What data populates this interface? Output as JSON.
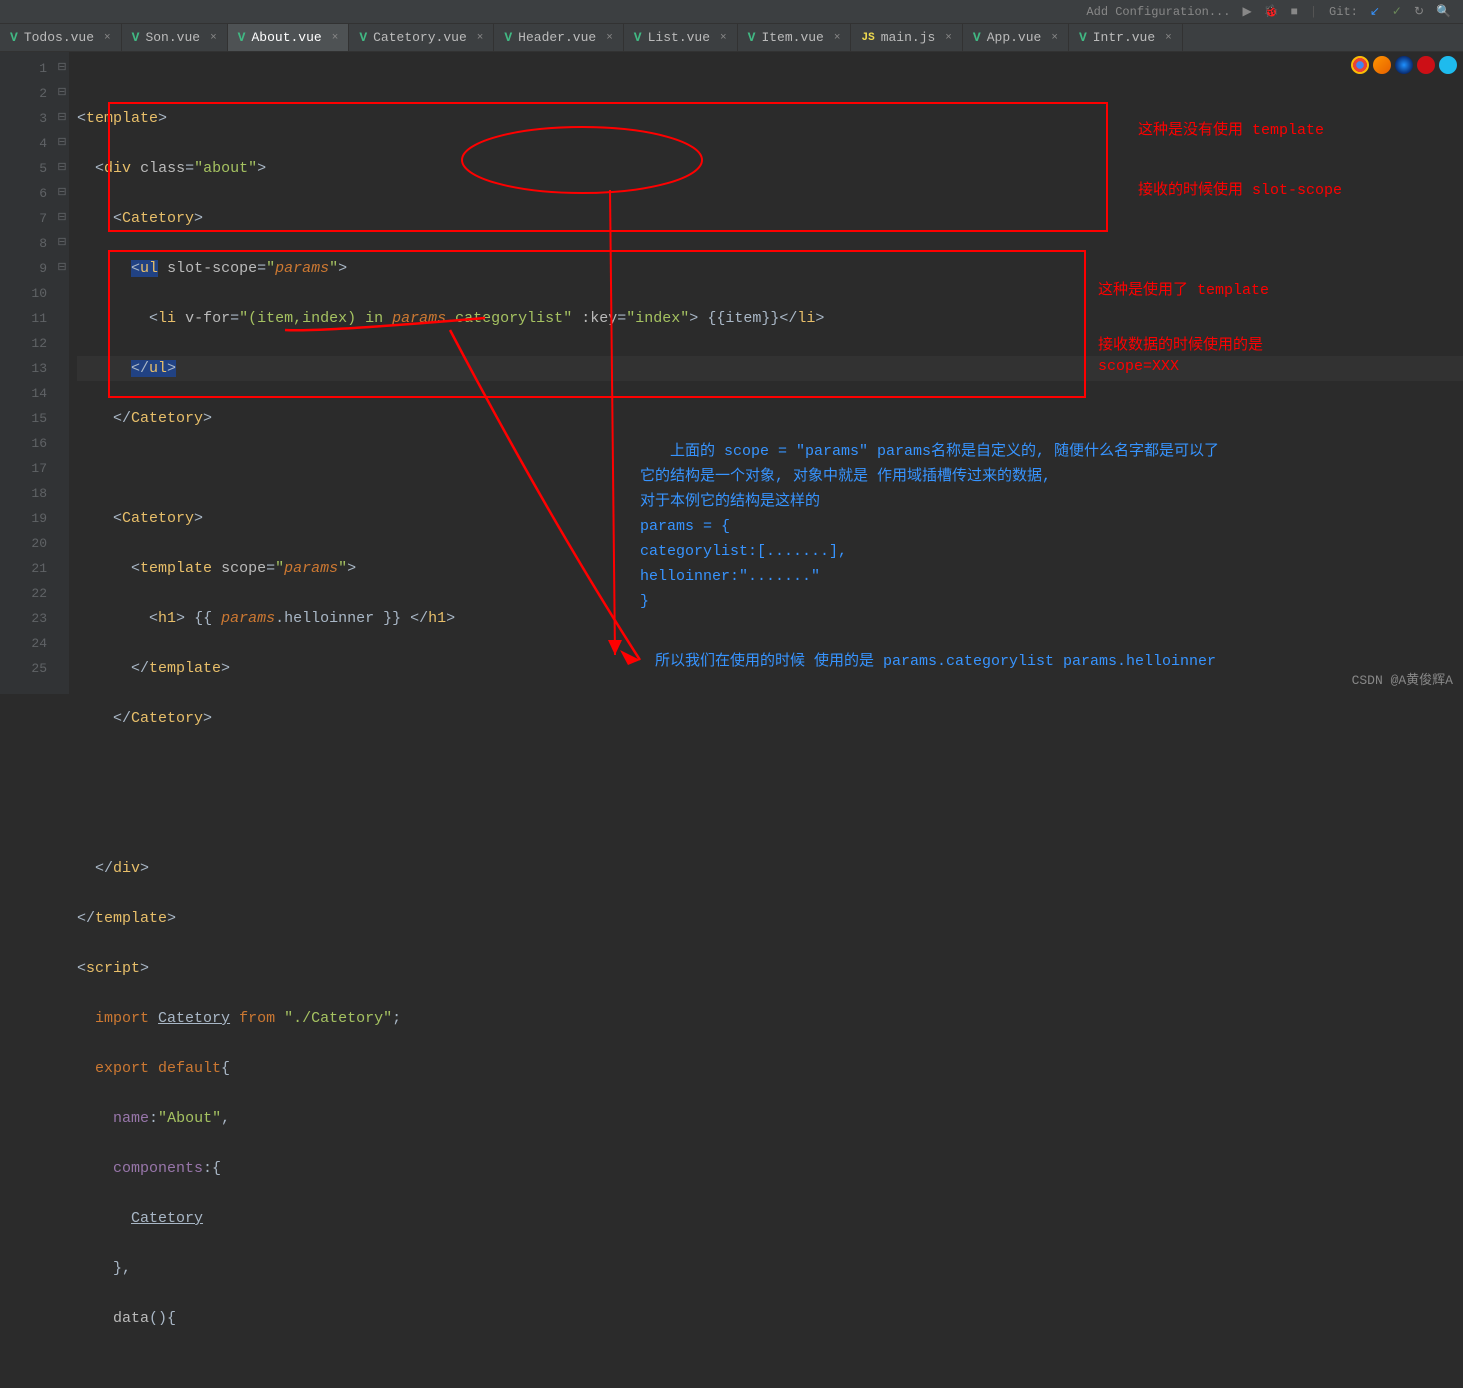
{
  "toolbar": {
    "config_label": "Add Configuration...",
    "git_label": "Git:"
  },
  "tabs": [
    {
      "icon": "V",
      "label": "Todos.vue",
      "active": false
    },
    {
      "icon": "V",
      "label": "Son.vue",
      "active": false
    },
    {
      "icon": "V",
      "label": "About.vue",
      "active": true
    },
    {
      "icon": "V",
      "label": "Catetory.vue",
      "active": false
    },
    {
      "icon": "V",
      "label": "Header.vue",
      "active": false
    },
    {
      "icon": "V",
      "label": "List.vue",
      "active": false
    },
    {
      "icon": "V",
      "label": "Item.vue",
      "active": false
    },
    {
      "icon": "JS",
      "label": "main.js",
      "active": false
    },
    {
      "icon": "V",
      "label": "App.vue",
      "active": false
    },
    {
      "icon": "V",
      "label": "Intr.vue",
      "active": false
    }
  ],
  "line_numbers": [
    "1",
    "2",
    "3",
    "4",
    "5",
    "6",
    "7",
    "8",
    "9",
    "10",
    "11",
    "12",
    "13",
    "14",
    "15",
    "16",
    "17",
    "18",
    "19",
    "20",
    "21",
    "22",
    "23",
    "24",
    "25"
  ],
  "code": {
    "l1": {
      "tag": "template"
    },
    "l2": {
      "tag": "div",
      "attr": "class",
      "val": "about"
    },
    "l3": {
      "tag": "Catetory"
    },
    "l4": {
      "tag": "ul",
      "attr": "slot-scope",
      "val": "params"
    },
    "l5": {
      "tag": "li",
      "attr1": "v-for",
      "val1": "(item,index) in ",
      "param": "params",
      "prop": ".categorylist",
      "attr2": ":key",
      "val2": "index",
      "text": " {{item}}",
      "close": "li"
    },
    "l6": {
      "close": "ul"
    },
    "l7": {
      "close": "Catetory"
    },
    "l9": {
      "tag": "Catetory"
    },
    "l10": {
      "tag": "template",
      "attr": "scope",
      "val": "params"
    },
    "l11": {
      "tag": "h1",
      "text1": " {{ ",
      "param": "params",
      "prop": ".helloinner",
      "text2": " }} ",
      "close": "h1"
    },
    "l12": {
      "close": "template"
    },
    "l13": {
      "close": "Catetory"
    },
    "l16": {
      "close": "div"
    },
    "l17": {
      "close": "template"
    },
    "l18": {
      "tag": "script"
    },
    "l19": {
      "kw": "import",
      "name": "Catetory",
      "kw2": "from",
      "str": "./Catetory"
    },
    "l20": {
      "kw": "export default"
    },
    "l21": {
      "prop": "name",
      "val": "About"
    },
    "l22": {
      "prop": "components"
    },
    "l23": {
      "name": "Catetory"
    },
    "l25": {
      "fn": "data"
    }
  },
  "annotations": {
    "red1": "这种是没有使用 template",
    "red2": "接收的时候使用 slot-scope",
    "red3": "这种是使用了 template",
    "red4": "接收数据的时候使用的是",
    "red5": "scope=XXX",
    "blue1": "上面的 scope = \"params\"  params名称是自定义的, 随便什么名字都是可以了",
    "blue2": "它的结构是一个对象, 对象中就是 作用域插槽传过来的数据,",
    "blue3": "对于本例它的结构是这样的",
    "blue4": "params = {",
    "blue5": "    categorylist:[.......],",
    "blue6": "    helloinner:\".......\"",
    "blue7": "}",
    "blue8": "所以我们在使用的时候  使用的是  params.categorylist  params.helloinner"
  },
  "watermark": "CSDN @A黄俊辉A"
}
